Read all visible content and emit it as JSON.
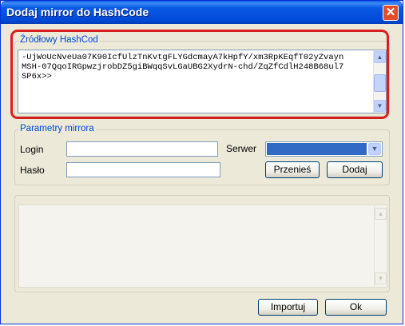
{
  "window": {
    "title": "Dodaj mirror do HashCode",
    "close_symbol": "✕"
  },
  "source": {
    "legend": "Źródłowy HashCod",
    "hash_text": "-UjWoUcNveUa07K90IcfUlzTnKvtgFLYGdcmayA7kHpfY/xm3RpKEqfT02yZvayn\nMSH-07QqoIRGpwzjrobDZ5giBWqqSvLGaUBG2XydrN-chd/ZqZfCdlH248B68ul7\nSP6x>>",
    "scroll_up": "▲",
    "scroll_down": "▼"
  },
  "mirror": {
    "legend": "Parametry mirrora",
    "login_label": "Login",
    "login_value": "",
    "password_label": "Hasło",
    "password_value": "",
    "server_label": "Serwer",
    "server_value": "",
    "combo_arrow": "▼",
    "move_button": "Przenieś",
    "add_button": "Dodaj"
  },
  "output": {
    "text": "",
    "scroll_up": "▲",
    "scroll_down": "▼"
  },
  "footer": {
    "import_button": "Importuj",
    "ok_button": "Ok"
  },
  "colors": {
    "title_bar": "#0a5ae6",
    "highlight": "#d62020",
    "legend_text": "#0046d5",
    "selection": "#316ac5"
  }
}
